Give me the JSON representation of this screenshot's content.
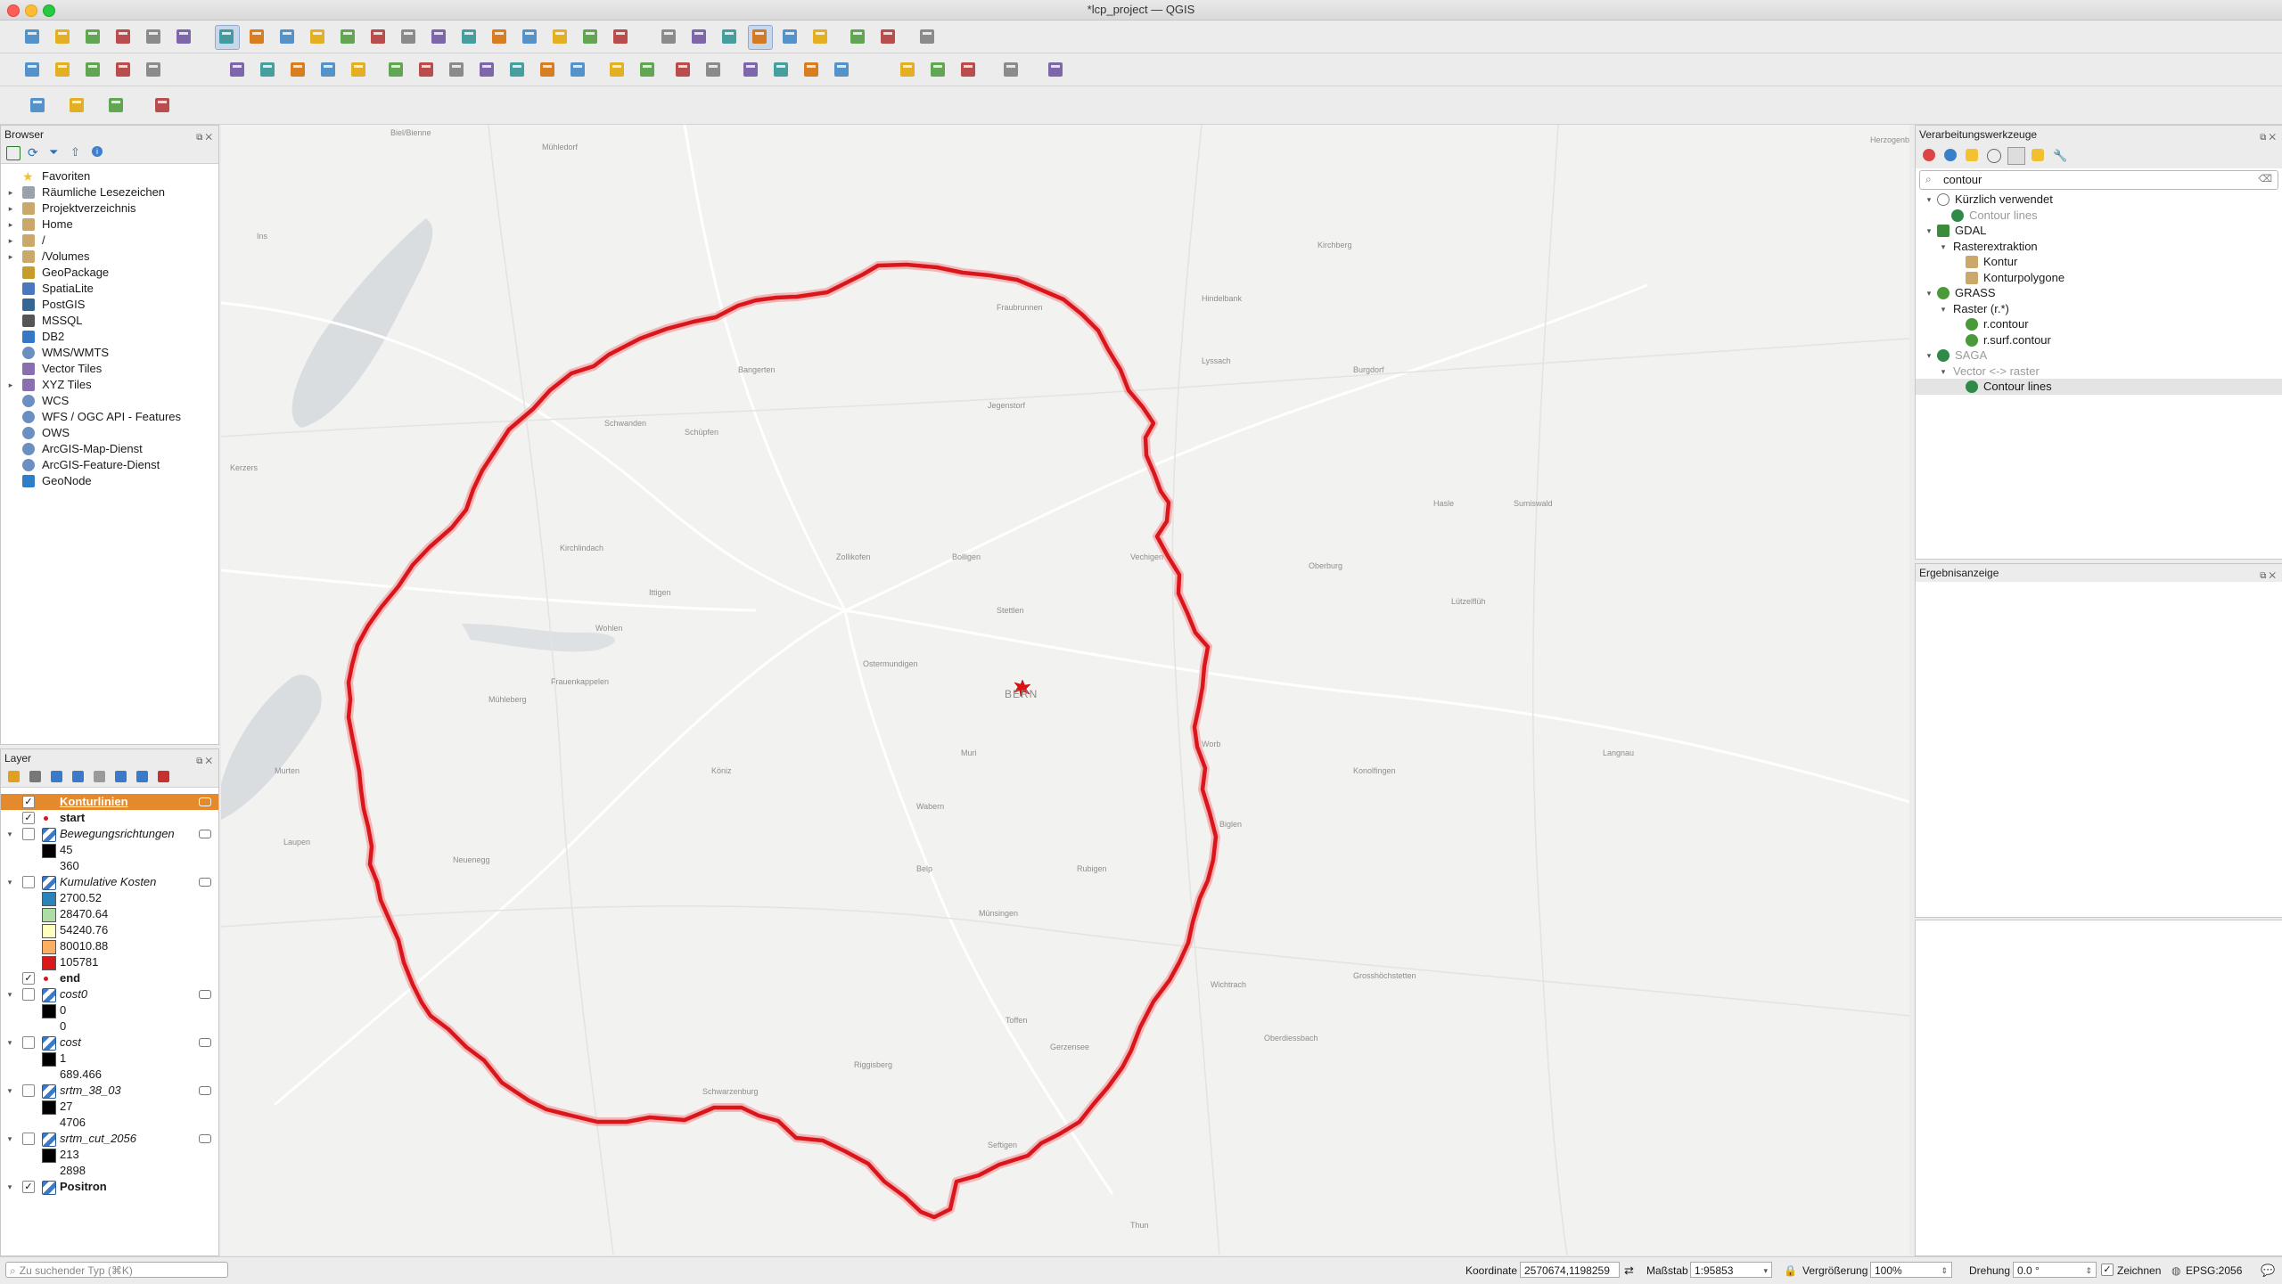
{
  "window": {
    "title": "*lcp_project — QGIS"
  },
  "browser_panel": {
    "title": "Browser",
    "items": [
      {
        "label": "Favoriten",
        "icon": "star-icon",
        "expandable": false
      },
      {
        "label": "Räumliche Lesezeichen",
        "icon": "bookmark-icon",
        "expandable": true
      },
      {
        "label": "Projektverzeichnis",
        "icon": "folder-icon",
        "expandable": true
      },
      {
        "label": "Home",
        "icon": "folder-icon",
        "expandable": true
      },
      {
        "label": "/",
        "icon": "folder-icon",
        "expandable": true
      },
      {
        "label": "/Volumes",
        "icon": "folder-icon",
        "expandable": true
      },
      {
        "label": "GeoPackage",
        "icon": "geopackage-icon",
        "expandable": false
      },
      {
        "label": "SpatiaLite",
        "icon": "spatialite-icon",
        "expandable": false
      },
      {
        "label": "PostGIS",
        "icon": "postgis-icon",
        "expandable": false
      },
      {
        "label": "MSSQL",
        "icon": "mssql-icon",
        "expandable": false
      },
      {
        "label": "DB2",
        "icon": "db2-icon",
        "expandable": false
      },
      {
        "label": "WMS/WMTS",
        "icon": "globe-icon",
        "expandable": false
      },
      {
        "label": "Vector Tiles",
        "icon": "grid-icon",
        "expandable": false
      },
      {
        "label": "XYZ Tiles",
        "icon": "grid-icon",
        "expandable": true
      },
      {
        "label": "WCS",
        "icon": "globe-icon",
        "expandable": false
      },
      {
        "label": "WFS / OGC API - Features",
        "icon": "globe-icon",
        "expandable": false
      },
      {
        "label": "OWS",
        "icon": "globe-icon",
        "expandable": false
      },
      {
        "label": "ArcGIS-Map-Dienst",
        "icon": "globe-icon",
        "expandable": false
      },
      {
        "label": "ArcGIS-Feature-Dienst",
        "icon": "globe-icon",
        "expandable": false
      },
      {
        "label": "GeoNode",
        "icon": "geonode-icon",
        "expandable": false
      }
    ]
  },
  "layers_panel": {
    "title": "Layer",
    "rows": [
      {
        "kind": "layer",
        "label": "Konturlinien",
        "checked": true,
        "highlight": true,
        "italic": false,
        "bold": true,
        "expand": false
      },
      {
        "kind": "layer",
        "label": "start",
        "checked": true,
        "italic": false,
        "bold": true,
        "point": true
      },
      {
        "kind": "layer",
        "label": "Bewegungsrichtungen",
        "checked": false,
        "italic": true,
        "bold": false,
        "expand": true,
        "raster": true
      },
      {
        "kind": "legend",
        "label": "45",
        "color": "#000000"
      },
      {
        "kind": "legend",
        "label": "360",
        "color": null
      },
      {
        "kind": "layer",
        "label": "Kumulative Kosten",
        "checked": false,
        "italic": true,
        "bold": false,
        "expand": true,
        "raster": true
      },
      {
        "kind": "legend",
        "label": "2700.52",
        "color": "#2b83ba"
      },
      {
        "kind": "legend",
        "label": "28470.64",
        "color": "#abdda4"
      },
      {
        "kind": "legend",
        "label": "54240.76",
        "color": "#ffffbf"
      },
      {
        "kind": "legend",
        "label": "80010.88",
        "color": "#fdae61"
      },
      {
        "kind": "legend",
        "label": "105781",
        "color": "#d7191c"
      },
      {
        "kind": "layer",
        "label": "end",
        "checked": true,
        "italic": false,
        "bold": true,
        "point": true
      },
      {
        "kind": "layer",
        "label": "cost0",
        "checked": false,
        "italic": true,
        "bold": false,
        "expand": true,
        "raster": true
      },
      {
        "kind": "legend",
        "label": "0",
        "color": "#000000"
      },
      {
        "kind": "legend",
        "label": "0",
        "color": null
      },
      {
        "kind": "layer",
        "label": "cost",
        "checked": false,
        "italic": true,
        "bold": false,
        "expand": true,
        "raster": true
      },
      {
        "kind": "legend",
        "label": "1",
        "color": "#000000"
      },
      {
        "kind": "legend",
        "label": "689.466",
        "color": null
      },
      {
        "kind": "layer",
        "label": "srtm_38_03",
        "checked": false,
        "italic": true,
        "bold": false,
        "expand": true,
        "raster": true
      },
      {
        "kind": "legend",
        "label": "27",
        "color": "#000000"
      },
      {
        "kind": "legend",
        "label": "4706",
        "color": null
      },
      {
        "kind": "layer",
        "label": "srtm_cut_2056",
        "checked": false,
        "italic": true,
        "bold": false,
        "expand": true,
        "raster": true
      },
      {
        "kind": "legend",
        "label": "213",
        "color": "#000000"
      },
      {
        "kind": "legend",
        "label": "2898",
        "color": null
      },
      {
        "kind": "layer",
        "label": "Positron",
        "checked": true,
        "italic": false,
        "bold": true,
        "expand": true,
        "raster": true
      }
    ]
  },
  "processing_panel": {
    "title": "Verarbeitungswerkzeuge",
    "search_value": "contour",
    "tree": [
      {
        "level": 0,
        "label": "Kürzlich verwendet",
        "icon": "clock-icon",
        "expand": true,
        "muted": false
      },
      {
        "level": 1,
        "label": "Contour lines",
        "icon": "saga-icon",
        "muted": true
      },
      {
        "level": 0,
        "label": "GDAL",
        "icon": "gdal-icon",
        "expand": true,
        "muted": false
      },
      {
        "level": 1,
        "label": "Rasterextraktion",
        "icon": null,
        "expand": true,
        "muted": false
      },
      {
        "level": 2,
        "label": "Kontur",
        "icon": "raster-tool-icon",
        "muted": false
      },
      {
        "level": 2,
        "label": "Konturpolygone",
        "icon": "raster-tool-icon",
        "muted": false
      },
      {
        "level": 0,
        "label": "GRASS",
        "icon": "grass-icon",
        "expand": true,
        "muted": false
      },
      {
        "level": 1,
        "label": "Raster (r.*)",
        "icon": null,
        "expand": true,
        "muted": false
      },
      {
        "level": 2,
        "label": "r.contour",
        "icon": "grass-icon",
        "muted": false
      },
      {
        "level": 2,
        "label": "r.surf.contour",
        "icon": "grass-icon",
        "muted": false
      },
      {
        "level": 0,
        "label": "SAGA",
        "icon": "saga-icon",
        "expand": true,
        "muted": true
      },
      {
        "level": 1,
        "label": "Vector <-> raster",
        "icon": null,
        "expand": true,
        "muted": true
      },
      {
        "level": 2,
        "label": "Contour lines",
        "icon": "saga-icon",
        "muted": false,
        "selected": true
      }
    ]
  },
  "results_panel": {
    "title": "Ergebnisanzeige"
  },
  "map": {
    "city_label": "BERN",
    "line_color": "#d9161c",
    "places": [
      "Biel/Bienne",
      "Mühledorf",
      "Herzogenbuchsee",
      "Ins",
      "Schüpfen",
      "Bangerten",
      "Zollikofen",
      "Ittigen",
      "Ostermundigen",
      "Burgdorf",
      "Köniz",
      "Muri",
      "Belp",
      "Münsingen",
      "Konolfingen",
      "Worb",
      "Kirchlindach",
      "Laupen",
      "Neuenegg",
      "Schwarzenburg",
      "Riggisberg",
      "Thun",
      "Wohlen",
      "Frauenkappelen",
      "Mühleberg",
      "Kerzers",
      "Murten",
      "Jegenstorf",
      "Fraubrunnen",
      "Hindelbank",
      "Lyssach",
      "Kirchberg",
      "Oberburg",
      "Hasle",
      "Biglen",
      "Grosshöchstetten",
      "Wichtrach",
      "Oberdiessbach",
      "Gerzensee",
      "Seftigen",
      "Toffen",
      "Rubigen",
      "Wabern",
      "Schwanden",
      "Bolligen",
      "Stettlen",
      "Vechigen",
      "Lützelflüh",
      "Sumiswald",
      "Langnau"
    ]
  },
  "status_bar": {
    "search_placeholder": "Zu suchender Typ (⌘K)",
    "coordinate_label": "Koordinate",
    "coordinate_value": "2570674,1198259",
    "scale_label": "Maßstab",
    "scale_value": "1:95853",
    "magnifier_label": "Vergrößerung",
    "magnifier_value": "100%",
    "rotation_label": "Drehung",
    "rotation_value": "0.0 °",
    "render_label": "Zeichnen",
    "crs_label": "EPSG:2056"
  }
}
